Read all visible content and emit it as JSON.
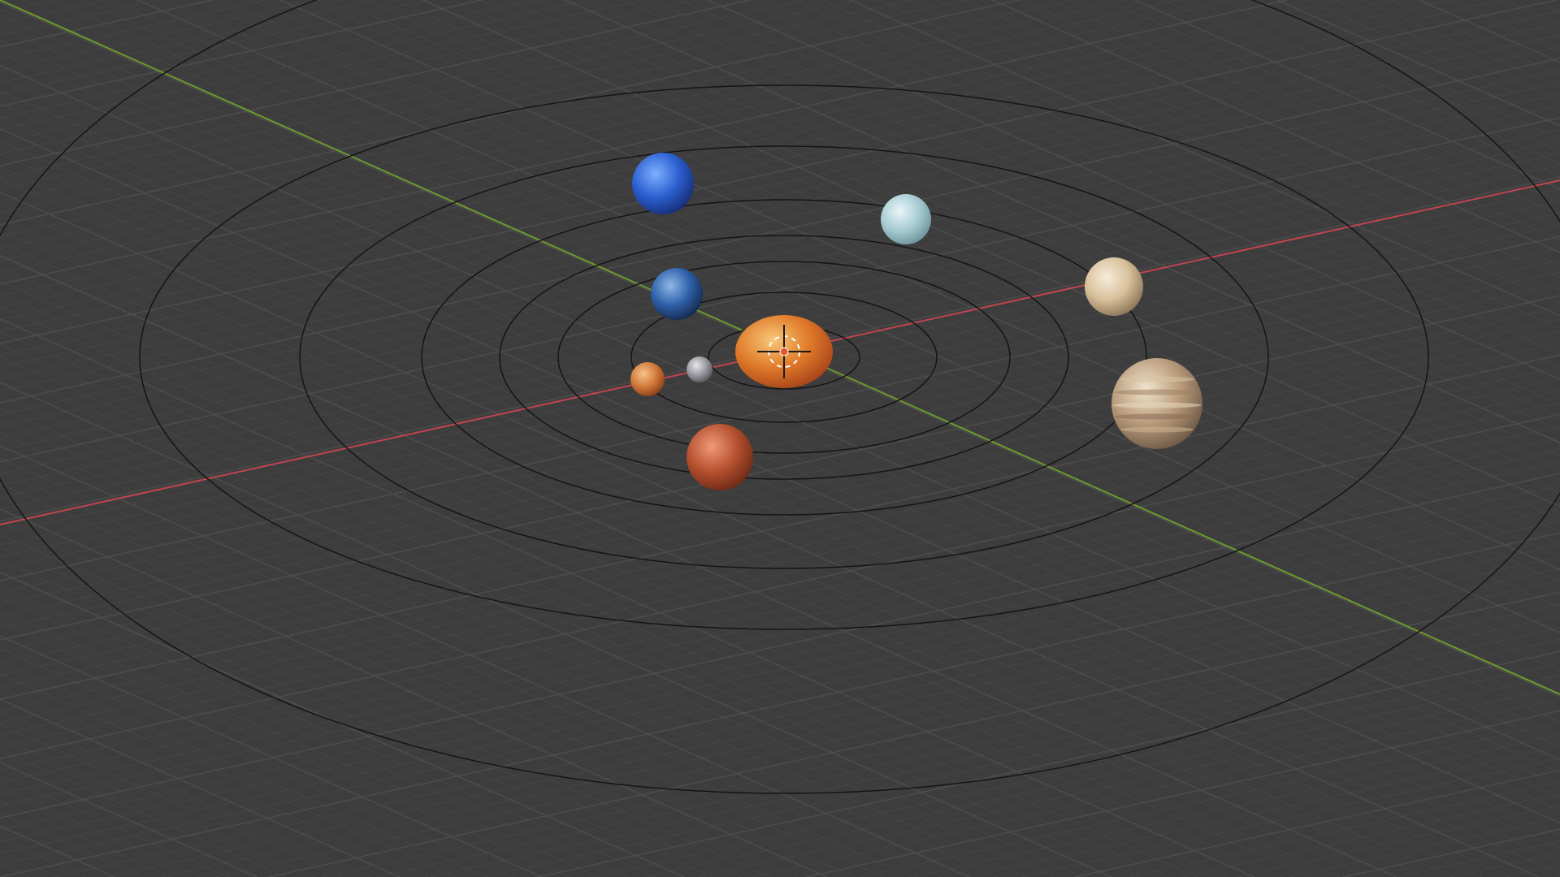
{
  "viewport": {
    "background_color": "#3d3d3d",
    "grid_minor_color": "#474747",
    "grid_major_color": "#525252",
    "x_axis_color": "#c04550",
    "y_axis_color": "#6d9a2e",
    "orbit_color": "#151515"
  },
  "scene": {
    "sun": {
      "icon": "sun-sphere-icon",
      "colors": [
        "#f6c878",
        "#e07a2a",
        "#a8441a"
      ]
    },
    "origin_cursor": {
      "icon": "3d-cursor-icon",
      "colors": [
        "#ffffff",
        "#e4572e"
      ]
    },
    "orbit_count": 8,
    "planets": [
      {
        "name": "mercury",
        "icon": "mercury-sphere-icon",
        "colors": [
          "#e6e6ea",
          "#9a9aa2",
          "#55555c"
        ]
      },
      {
        "name": "venus",
        "icon": "venus-sphere-icon",
        "colors": [
          "#f6c58a",
          "#d27a3c",
          "#8a3f18"
        ]
      },
      {
        "name": "earth",
        "icon": "earth-sphere-icon",
        "colors": [
          "#8fb8e8",
          "#2e5fa8",
          "#16294e"
        ]
      },
      {
        "name": "mars",
        "icon": "mars-sphere-icon",
        "colors": [
          "#f09a7a",
          "#b5502f",
          "#6e2a16"
        ]
      },
      {
        "name": "jupiter",
        "icon": "jupiter-sphere-icon",
        "colors": [
          "#f1e4cf",
          "#b89a7a",
          "#6e5a48"
        ]
      },
      {
        "name": "saturn",
        "icon": "saturn-sphere-icon",
        "colors": [
          "#f6eddb",
          "#d8c09a",
          "#8d7658"
        ]
      },
      {
        "name": "uranus",
        "icon": "uranus-sphere-icon",
        "colors": [
          "#e9f6f8",
          "#a8ccd4",
          "#6d949c"
        ]
      },
      {
        "name": "neptune",
        "icon": "neptune-sphere-icon",
        "colors": [
          "#7fb0ff",
          "#2b5fd0",
          "#172e78"
        ]
      }
    ]
  }
}
